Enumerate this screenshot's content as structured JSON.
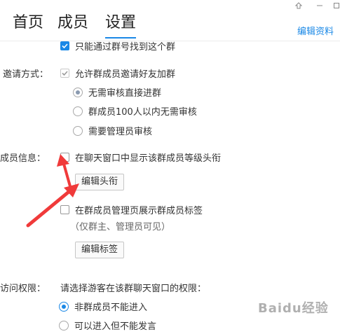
{
  "header": {
    "tabs": [
      {
        "label": "首页"
      },
      {
        "label": "成员"
      },
      {
        "label": "设置"
      }
    ],
    "edit_profile": "编辑资料",
    "accent_color": "#1a88e6"
  },
  "settings": {
    "find_by_number_only": {
      "label": "只能通过群号找到这个群",
      "checked": true
    },
    "invite": {
      "section_label": "邀请方式：",
      "allow_invite": {
        "label": "允许群成员邀请好友加群",
        "checked": true
      },
      "options": [
        {
          "label": "无需审核直接进群",
          "selected": true
        },
        {
          "label": "群成员100人以内无需审核",
          "selected": false
        },
        {
          "label": "需要管理员审核",
          "selected": false
        }
      ]
    },
    "member_info": {
      "section_label": "成员信息：",
      "show_rank_title": {
        "label": "在聊天窗口中显示该群成员等级头衔",
        "checked": false
      },
      "edit_title_button": "编辑头衔",
      "show_tags": {
        "label": "在群成员管理页展示群成员标签",
        "checked": false
      },
      "tags_note": "（仅群主、管理员可见）",
      "edit_tags_button": "编辑标签"
    },
    "access": {
      "section_label": "访问权限：",
      "prompt": "请选择游客在该群聊天窗口的权限：",
      "options": [
        {
          "label": "非群成员不能进入",
          "selected": true
        },
        {
          "label": "可以进入但不能发言",
          "selected": false
        }
      ]
    }
  },
  "watermark": "Baidu经验",
  "annotation_arrow_color": "#f03a3a"
}
